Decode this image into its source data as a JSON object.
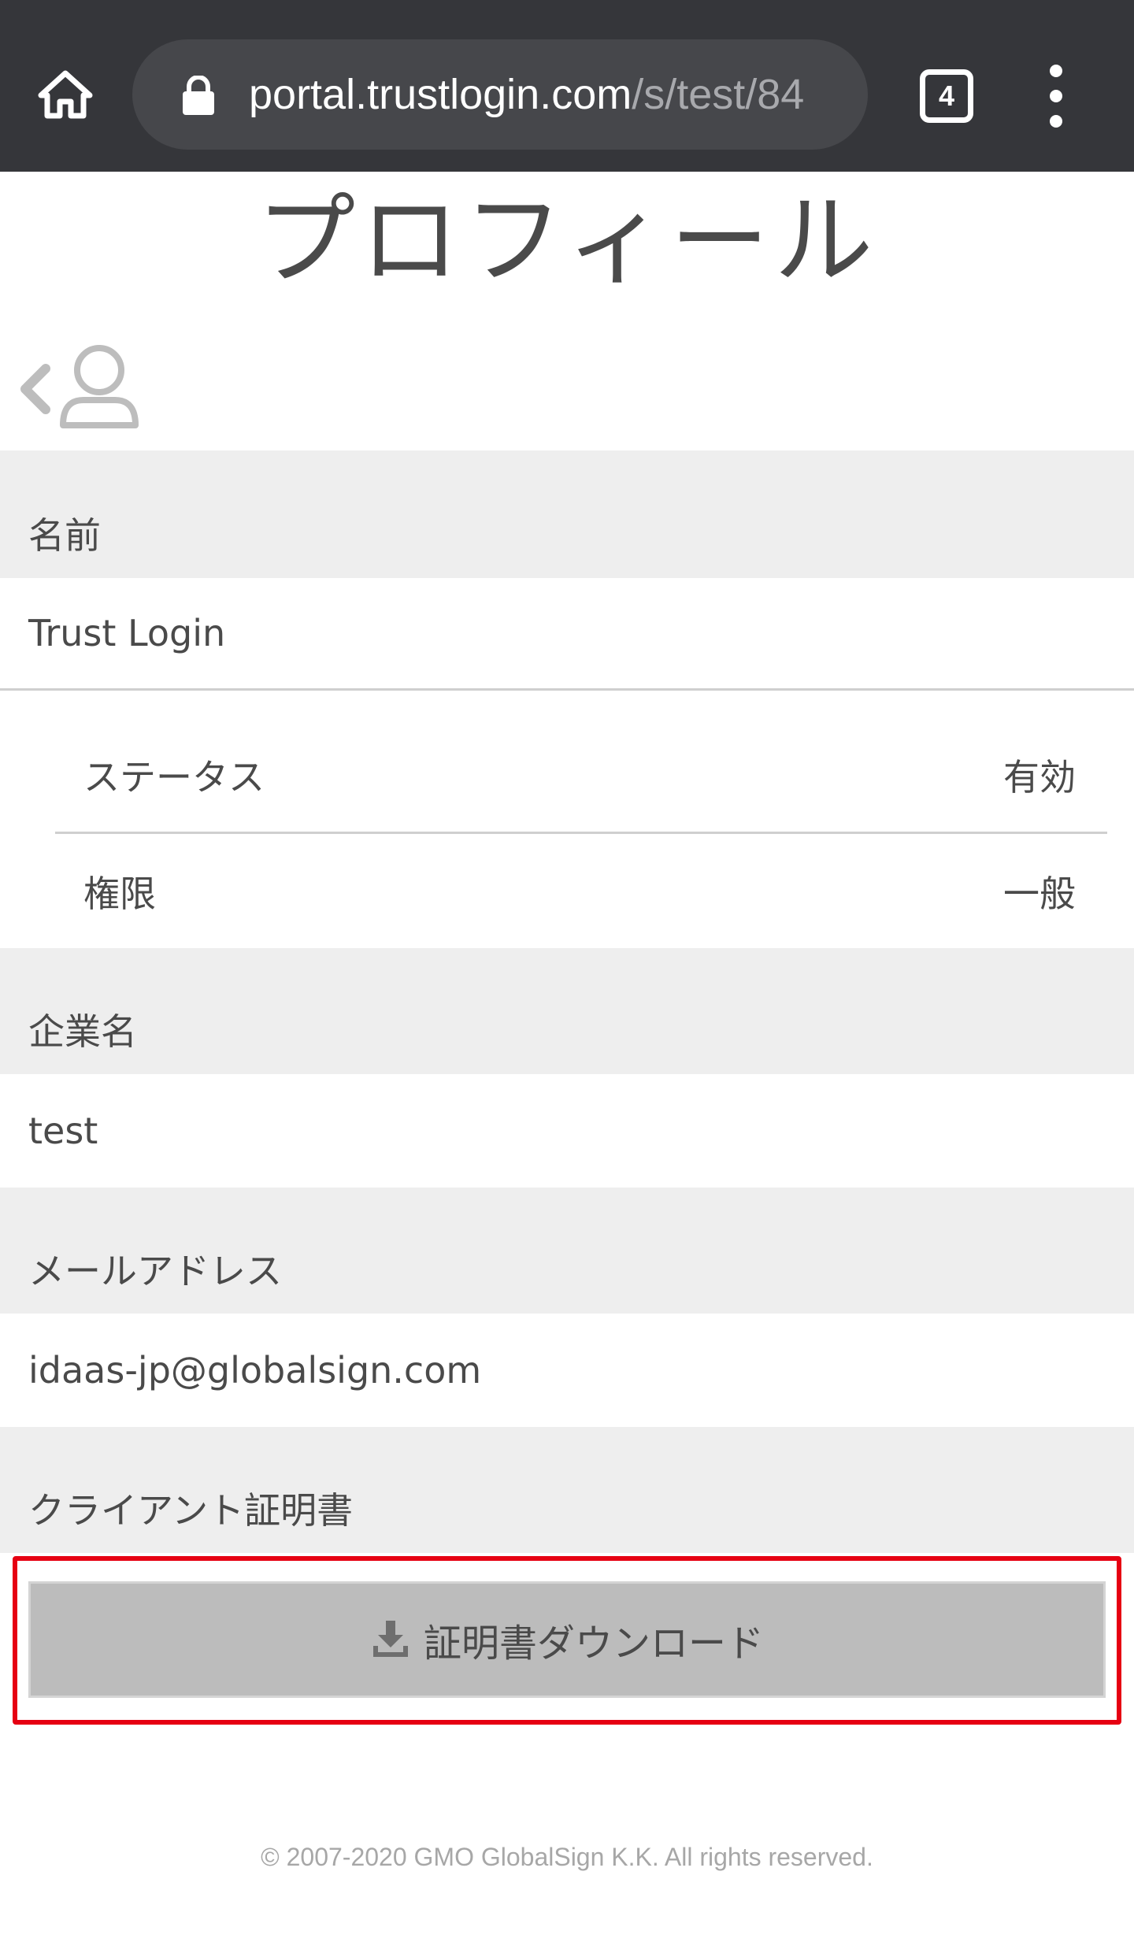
{
  "browser": {
    "url_host": "portal.trustlogin.com",
    "url_path": "/s/test/84",
    "tab_count": "4"
  },
  "page": {
    "title": "プロフィール"
  },
  "profile": {
    "name_label": "名前",
    "name_value": "Trust Login",
    "status_label": "ステータス",
    "status_value": "有効",
    "role_label": "権限",
    "role_value": "一般",
    "company_label": "企業名",
    "company_value": "test",
    "email_label": "メールアドレス",
    "email_value": "idaas-jp@globalsign.com",
    "cert_label": "クライアント証明書",
    "download_label": "証明書ダウンロード"
  },
  "footer": {
    "copyright": "© 2007-2020 GMO GlobalSign K.K. All rights reserved."
  },
  "colors": {
    "chrome_bar": "#35363a",
    "label_bg": "#eeeeee",
    "button_bg": "#bcbcbc",
    "highlight": "#e60012"
  }
}
